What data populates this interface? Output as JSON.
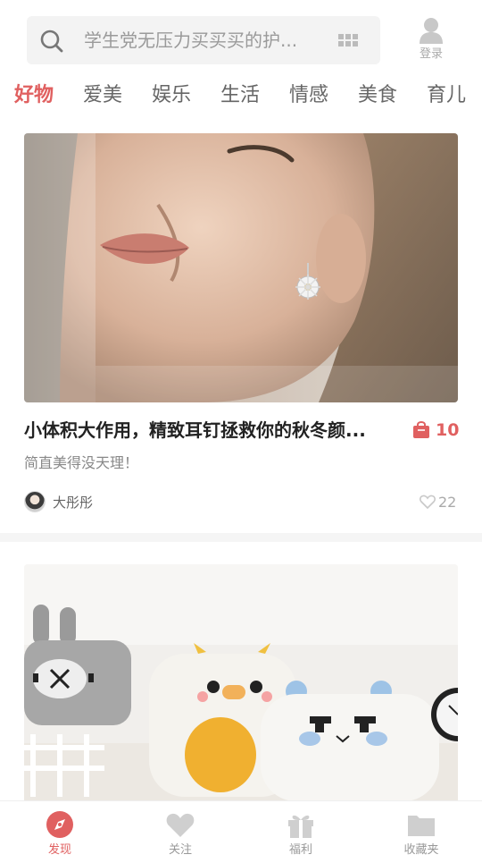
{
  "search": {
    "placeholder": "学生党无压力买买买的护..."
  },
  "login": {
    "label": "登录"
  },
  "tabs": [
    {
      "label": "好物",
      "active": true
    },
    {
      "label": "爱美",
      "active": false
    },
    {
      "label": "娱乐",
      "active": false
    },
    {
      "label": "生活",
      "active": false
    },
    {
      "label": "情感",
      "active": false
    },
    {
      "label": "美食",
      "active": false
    },
    {
      "label": "育儿",
      "active": false
    }
  ],
  "feed": [
    {
      "image": "woman-with-earring-photo",
      "title": "小体积大作用，精致耳钉拯救你的秋冬颜...",
      "product_count": "10",
      "subtitle": "简直美得没天理！",
      "author": "大彤彤",
      "likes": "22"
    },
    {
      "image": "cute-plush-pencil-cases-photo"
    }
  ],
  "bottom_nav": [
    {
      "label": "发现",
      "icon": "compass-icon",
      "active": true
    },
    {
      "label": "关注",
      "icon": "heart-icon",
      "active": false
    },
    {
      "label": "福利",
      "icon": "gift-icon",
      "active": false
    },
    {
      "label": "收藏夹",
      "icon": "folder-icon",
      "active": false
    }
  ],
  "colors": {
    "accent": "#e06060",
    "inactive": "#cfcfcf",
    "search_bg": "#f3f3f3"
  }
}
